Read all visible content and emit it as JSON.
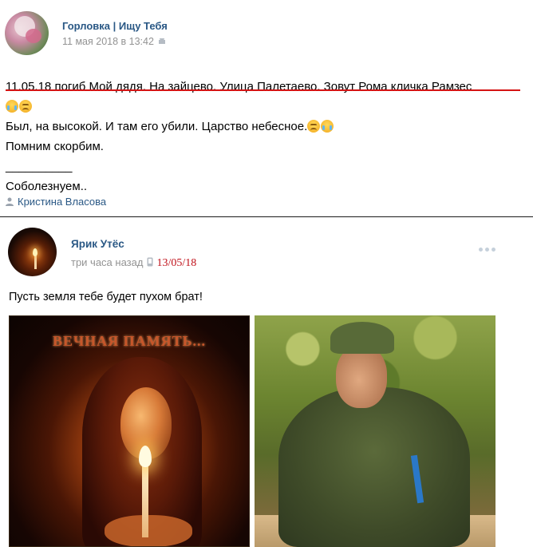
{
  "post1": {
    "group_name": "Горловка | Ищу Тебя",
    "time": "11 мая 2018 в 13:42",
    "lines": [
      "11.05.18 погиб Мой дядя. На зайцево. Улица Палетаево. Зовут Рома кличка Рамзес",
      "Был, на высокой. И там его убили. Царство небесное.",
      "Помним скорбим.",
      "__________",
      "Соболезнуем.."
    ],
    "author": "Кристина Власова"
  },
  "post2": {
    "user_name": "Ярик Утёс",
    "time": "три часа назад",
    "date_annotation": "13/05/18",
    "text": "Пусть земля тебе будет пухом брат!",
    "photo1_caption": "ВЕЧНАЯ ПАМЯТЬ..."
  },
  "colors": {
    "link": "#2a5885",
    "meta": "#939393",
    "annotation_red": "#c0111a"
  },
  "icons": [
    "android-icon",
    "author-icon",
    "phone-icon",
    "more-icon",
    "crying-face-emoji",
    "disappointed-face-emoji"
  ]
}
